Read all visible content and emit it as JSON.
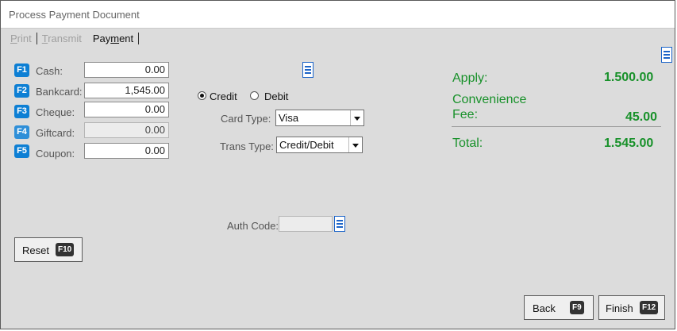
{
  "window": {
    "title": "Process Payment Document"
  },
  "tabs": [
    {
      "label": "Print",
      "mnemonic": "P",
      "rest": "rint"
    },
    {
      "label": "Transmit",
      "mnemonic": "T",
      "rest": "ransmit"
    },
    {
      "label": "Payment",
      "pre": "Pay",
      "mnemonic": "m",
      "rest": "ent"
    }
  ],
  "tenders": [
    {
      "key": "F1",
      "label": "Cash:",
      "value": "0.00"
    },
    {
      "key": "F2",
      "label": "Bankcard:",
      "value": "1,545.00"
    },
    {
      "key": "F3",
      "label": "Cheque:",
      "value": "0.00"
    },
    {
      "key": "F4",
      "label": "Giftcard:",
      "value": "0.00"
    },
    {
      "key": "F5",
      "label": "Coupon:",
      "value": "0.00"
    }
  ],
  "card": {
    "credit_label": "Credit",
    "debit_label": "Debit",
    "selected": "Credit",
    "card_type_label": "Card Type:",
    "card_type_value": "Visa",
    "trans_type_label": "Trans Type:",
    "trans_type_value": "Credit/Debit",
    "auth_code_label": "Auth Code:",
    "auth_code_value": ""
  },
  "summary": {
    "apply_label": "Apply:",
    "apply_value": "1.500.00",
    "fee_label_line1": "Convenience",
    "fee_label_line2": "Fee:",
    "fee_value": "45.00",
    "total_label": "Total:",
    "total_value": "1.545.00"
  },
  "buttons": {
    "reset_label": "Reset",
    "reset_key": "F10",
    "back_label": "Back",
    "back_key": "F9",
    "finish_label": "Finish",
    "finish_key": "F12"
  },
  "icons": [
    "menu-list-icon",
    "radio-icon",
    "dropdown-arrow-icon"
  ],
  "colors": {
    "fkey": "#0d7fd4",
    "summary_text": "#18912a",
    "icon_blue": "#1c64c8"
  }
}
